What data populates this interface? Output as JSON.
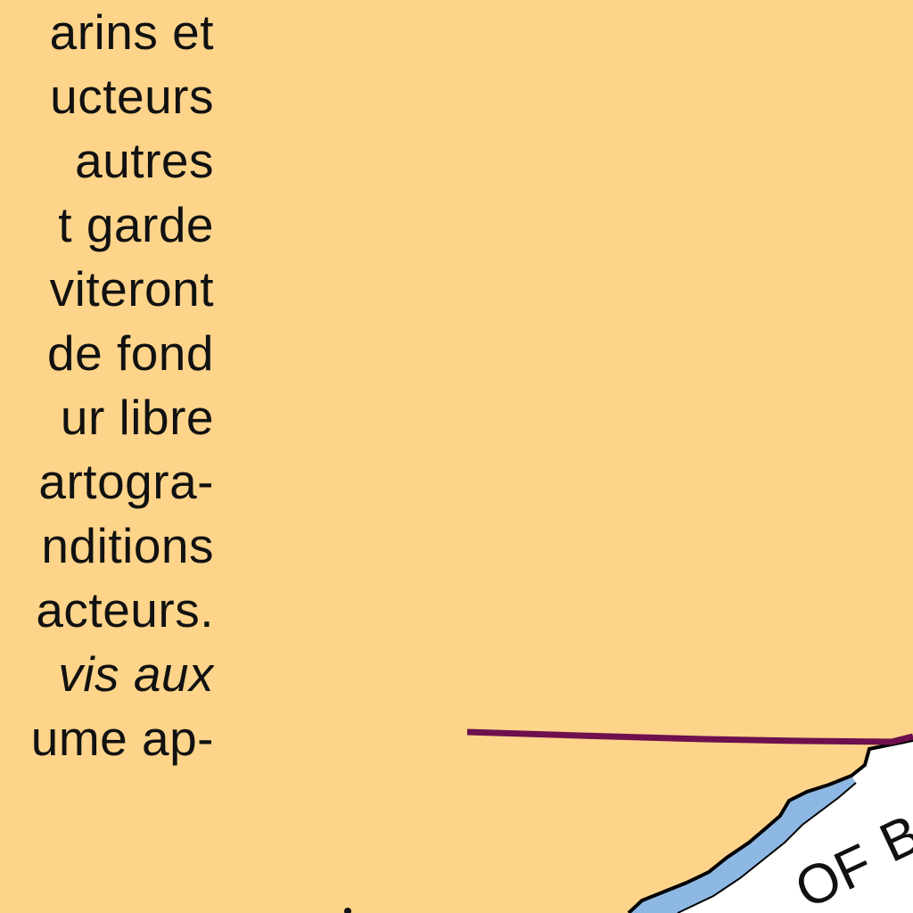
{
  "notice_text": {
    "lines": [
      "arins et",
      "ucteurs",
      "autres",
      "t garde",
      "viteront",
      "de fond",
      "ur libre",
      "artogra-",
      "nditions",
      "acteurs.",
      "vis aux",
      "ume ap-"
    ],
    "italic_line_index": 10
  },
  "map": {
    "labels": {
      "water_label_left": "OF",
      "water_label_right": "B"
    },
    "colors": {
      "land": "#FDD48A",
      "water": "#FFFFFF",
      "shallow_water": "#8DB8E3",
      "boundary": "#6E0F4E",
      "coastline": "#000000"
    }
  }
}
